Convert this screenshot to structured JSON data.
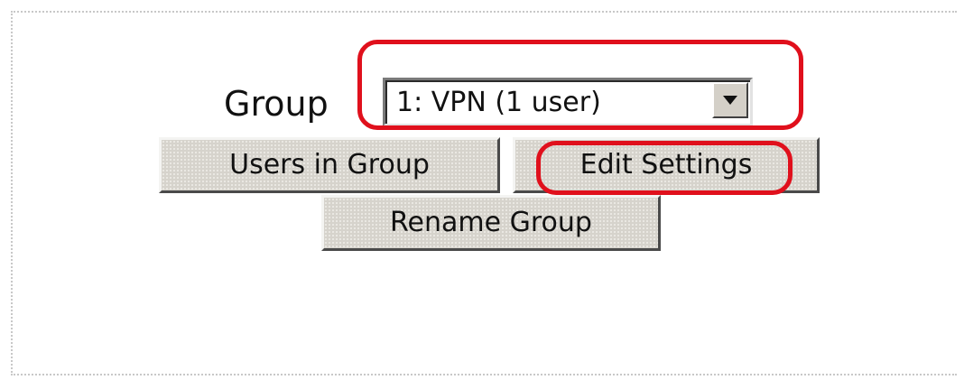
{
  "group": {
    "label": "Group",
    "selected_value": "1: VPN (1 user)"
  },
  "buttons": {
    "users_in_group": "Users in Group",
    "edit_settings": "Edit Settings",
    "rename_group": "Rename Group"
  },
  "icons": {
    "dropdown_arrow": "chevron-down-icon"
  },
  "colors": {
    "highlight": "#e0101c",
    "button_face": "#d6d3cc",
    "panel_border": "#c8c8c8"
  }
}
